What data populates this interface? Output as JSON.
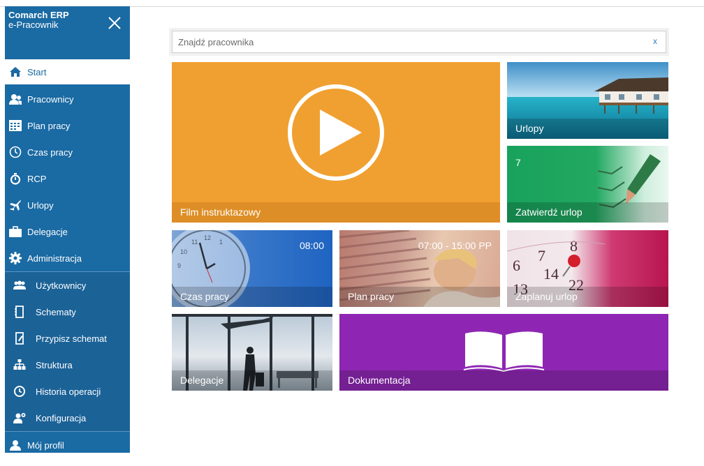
{
  "app": {
    "name": "Comarch ERP",
    "module": "e-Pracownik"
  },
  "sidebar": {
    "items": [
      {
        "label": "Start",
        "icon": "home-icon",
        "active": true
      },
      {
        "label": "Pracownicy",
        "icon": "users-icon"
      },
      {
        "label": "Plan pracy",
        "icon": "calendar-grid-icon"
      },
      {
        "label": "Czas pracy",
        "icon": "clock-icon"
      },
      {
        "label": "RCP",
        "icon": "stopwatch-icon"
      },
      {
        "label": "Urlopy",
        "icon": "airplane-icon"
      },
      {
        "label": "Delegacje",
        "icon": "briefcase-icon"
      },
      {
        "label": "Administracja",
        "icon": "gear-icon"
      }
    ],
    "sub_items": [
      {
        "label": "Użytkownicy",
        "icon": "group-icon"
      },
      {
        "label": "Schematy",
        "icon": "document-icon"
      },
      {
        "label": "Przypisz schemat",
        "icon": "document-edit-icon"
      },
      {
        "label": "Struktura",
        "icon": "hierarchy-icon"
      },
      {
        "label": "Historia operacji",
        "icon": "history-icon"
      },
      {
        "label": "Konfiguracja",
        "icon": "user-settings-icon"
      }
    ],
    "profile": {
      "label": "Mój profil",
      "icon": "user-icon"
    }
  },
  "search": {
    "placeholder": "Znajdź pracownika",
    "value": "",
    "clear": "x"
  },
  "tiles": {
    "film": {
      "label": "Film instruktazowy",
      "color": "#f0a030"
    },
    "urlopy": {
      "label": "Urlopy"
    },
    "zatwierdz": {
      "label": "Zatwierdź urlop",
      "count": "7",
      "color": "#1ba35e"
    },
    "czas": {
      "label": "Czas pracy",
      "value": "08:00",
      "color": "#1f64c2"
    },
    "plan": {
      "label": "Plan pracy",
      "value": "07:00 - 15:00 PP"
    },
    "zaplanuj": {
      "label": "Zaplanuj urlop",
      "color": "#b8154f"
    },
    "delegacje": {
      "label": "Delegacje"
    },
    "dokumentacja": {
      "label": "Dokumentacja",
      "color": "#8e26b3"
    }
  }
}
